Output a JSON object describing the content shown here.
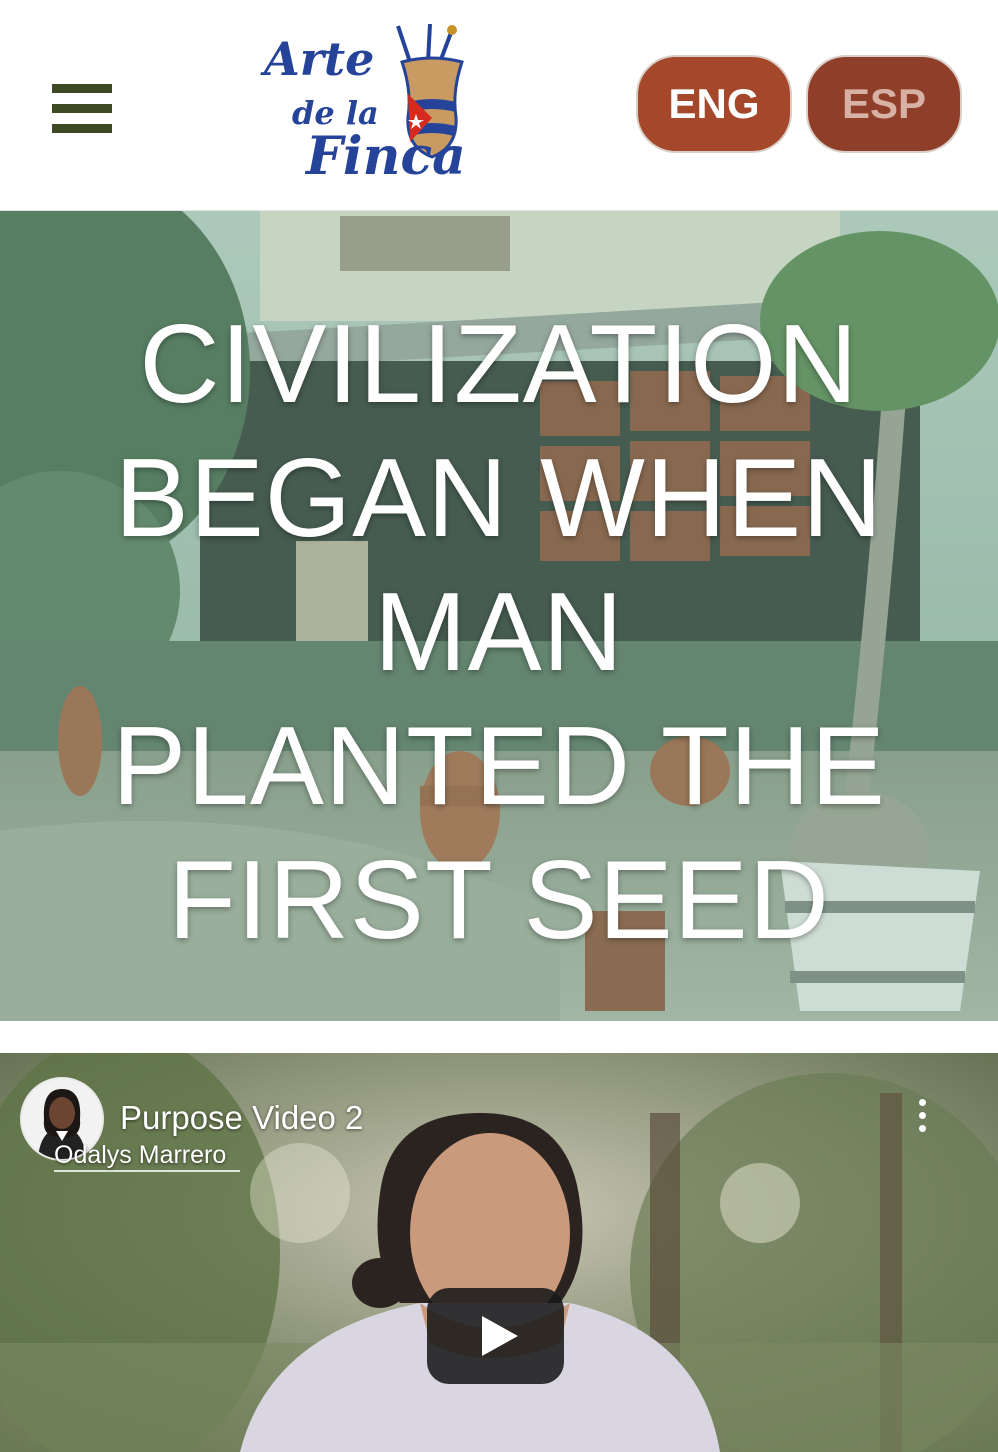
{
  "header": {
    "menu_icon": "hamburger-menu-icon",
    "logo": {
      "line1": "Arte",
      "line2": "de la",
      "line3": "Finca"
    },
    "languages": [
      {
        "label": "ENG"
      },
      {
        "label": "ESP"
      }
    ]
  },
  "hero": {
    "title_lines": [
      "CIVILIZATION",
      "BEGAN WHEN",
      "MAN",
      "PLANTED THE",
      "FIRST SEED"
    ]
  },
  "video": {
    "title": "Purpose Video 2",
    "channel": "Odalys Marrero",
    "menu_icon": "more-vertical-icon",
    "play_icon": "play-icon"
  },
  "colors": {
    "menu": "#3e4a22",
    "logo_blue": "#26439a",
    "eng_bg": "#a5472b",
    "esp_bg": "#8f3e29",
    "esp_text": "#d7b2a4"
  }
}
